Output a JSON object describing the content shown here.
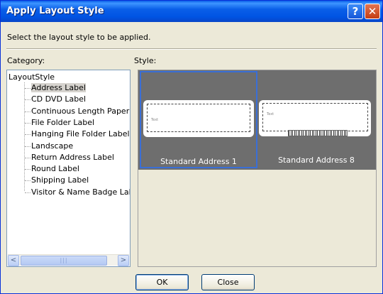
{
  "window": {
    "title": "Apply Layout Style",
    "help_glyph": "?",
    "close_glyph": "✕",
    "accent": "#0054e3"
  },
  "instruction": "Select the layout style to be applied.",
  "category": {
    "label": "Category:",
    "root": "LayoutStyle",
    "items": [
      {
        "label": "Address Label",
        "selected": true
      },
      {
        "label": "CD DVD Label",
        "selected": false
      },
      {
        "label": "Continuous Length Paper and",
        "selected": false
      },
      {
        "label": "File Folder Label",
        "selected": false
      },
      {
        "label": "Hanging File Folder Label",
        "selected": false
      },
      {
        "label": "Landscape",
        "selected": false
      },
      {
        "label": "Return Address Label",
        "selected": false
      },
      {
        "label": "Round Label",
        "selected": false
      },
      {
        "label": "Shipping Label",
        "selected": false
      },
      {
        "label": "Visitor & Name Badge Label",
        "selected": false
      }
    ],
    "scroll_left_glyph": "<",
    "scroll_right_glyph": ">",
    "thumb_grip": "|||"
  },
  "style": {
    "label": "Style:",
    "tiles": [
      {
        "name": "Standard Address 1",
        "selected": true,
        "placeholder": "Text"
      },
      {
        "name": "Standard Address 8",
        "selected": false,
        "placeholder": "Text"
      }
    ]
  },
  "buttons": {
    "ok": "OK",
    "close": "Close"
  }
}
